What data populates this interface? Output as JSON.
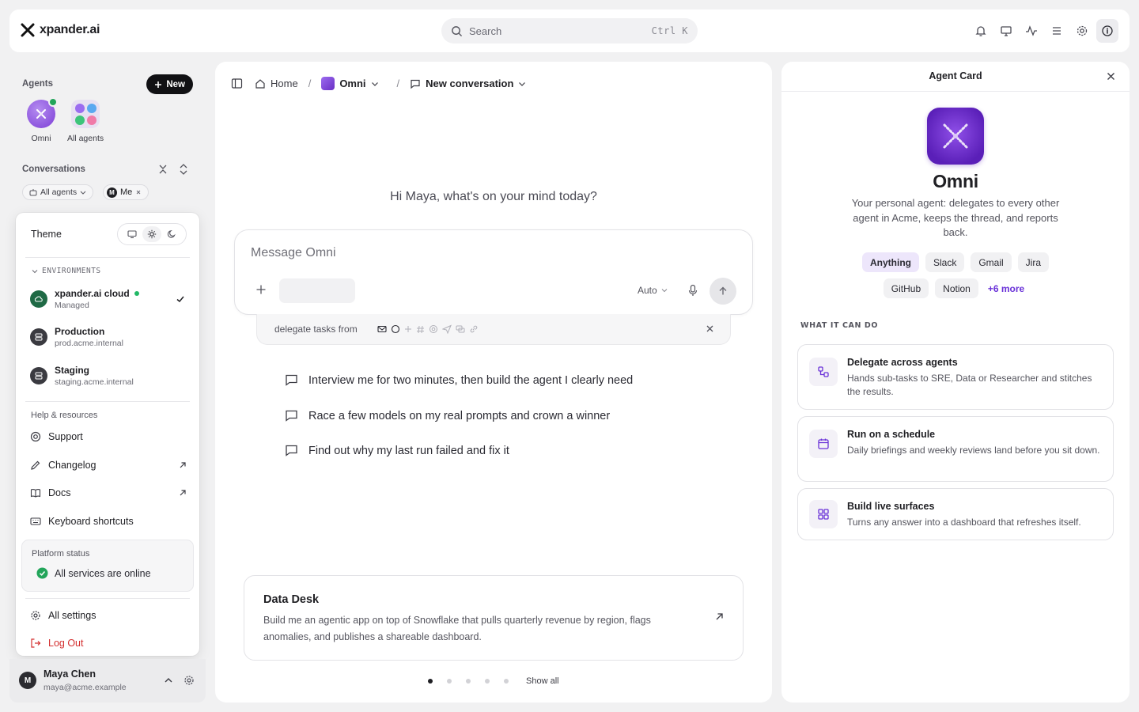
{
  "brand": {
    "name": "xpander.ai"
  },
  "search": {
    "placeholder": "Search",
    "shortcut": "Ctrl K"
  },
  "top_icons": [
    "bell-icon",
    "monitor-icon",
    "activity-icon",
    "menu-icon",
    "gear-icon",
    "info-icon"
  ],
  "sidebar": {
    "agents_label": "Agents",
    "new_label": "New",
    "agents": [
      {
        "label": "Omni"
      },
      {
        "label": "All agents"
      }
    ],
    "conversations_label": "Conversations",
    "filters": {
      "all_agents": "All agents",
      "me": "Me",
      "me_avatar": "M"
    }
  },
  "menu": {
    "theme_label": "Theme",
    "env_heading": "ENVIRONMENTS",
    "environments": [
      {
        "name": "xpander.ai cloud",
        "sub": "Managed",
        "selected": true,
        "online": true
      },
      {
        "name": "Production",
        "sub": "prod.acme.internal"
      },
      {
        "name": "Staging",
        "sub": "staging.acme.internal"
      }
    ],
    "help_heading": "Help & resources",
    "help_items": [
      {
        "label": "Support"
      },
      {
        "label": "Changelog"
      },
      {
        "label": "Docs"
      },
      {
        "label": "Keyboard shortcuts"
      }
    ],
    "platform_status_label": "Platform status",
    "platform_status_value": "All services are online",
    "all_settings": "All settings",
    "logout": "Log Out"
  },
  "user": {
    "initial": "M",
    "name": "Maya Chen",
    "email": "maya@acme.example"
  },
  "main": {
    "breadcrumb": {
      "home": "Home",
      "agent": "Omni",
      "conversation": "New conversation"
    },
    "greeting": "Hi Maya, what's on your mind today?",
    "composer": {
      "placeholder": "Message Omni",
      "model": "Auto"
    },
    "delegate": {
      "label": "delegate tasks from"
    },
    "suggestions": [
      "Interview me for two minutes, then build the agent I clearly need",
      "Race a few models on my real prompts and crown a winner",
      "Find out why my last run failed and fix it"
    ],
    "featured": {
      "title": "Data Desk",
      "desc": "Build me an agentic app on top of Snowflake that pulls quarterly revenue by region, flags anomalies, and publishes a shareable dashboard."
    },
    "pager": {
      "count": 5,
      "active": 0,
      "show_all": "Show all"
    }
  },
  "agent_card": {
    "header": "Agent Card",
    "name": "Omni",
    "desc": "Your personal agent: delegates to every other agent in Acme, keeps the thread, and reports back.",
    "tags": [
      "Anything",
      "Slack",
      "Gmail",
      "Jira",
      "GitHub",
      "Notion",
      "+6 more"
    ],
    "what_label": "WHAT IT CAN DO",
    "capabilities": [
      {
        "title": "Delegate across agents",
        "desc": "Hands sub-tasks to SRE, Data or Researcher and stitches the results.",
        "icon": "delegate-icon"
      },
      {
        "title": "Run on a schedule",
        "desc": "Daily briefings and weekly reviews land before you sit down.",
        "icon": "calendar-icon"
      },
      {
        "title": "Build live surfaces",
        "desc": "Turns any answer into a dashboard that refreshes itself.",
        "icon": "grid-icon"
      }
    ]
  },
  "colors": {
    "accent": "#6a32d8",
    "online": "#22a55a",
    "logout": "#d42f2f"
  }
}
